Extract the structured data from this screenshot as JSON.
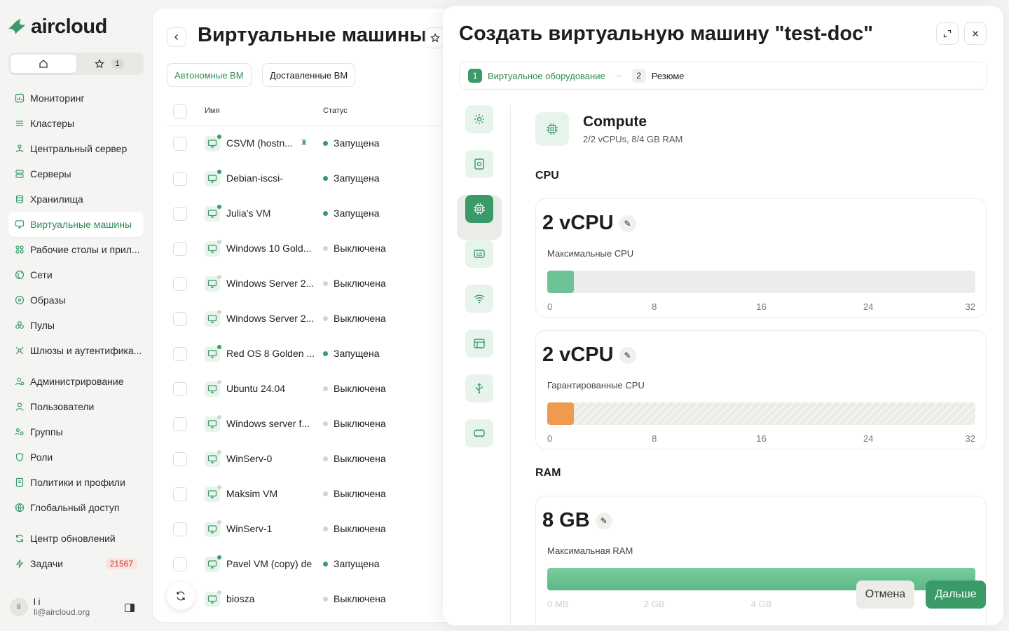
{
  "brand": {
    "name": "aircloud",
    "accent": "#3a9a68",
    "off_dot": "#d4d4d0",
    "on_dot": "#3a9a68"
  },
  "favorites": {
    "count": "1"
  },
  "nav": [
    {
      "label": "Мониторинг",
      "icon": "chart-icon"
    },
    {
      "label": "Кластеры",
      "icon": "layers-icon"
    },
    {
      "label": "Центральный сервер",
      "icon": "hub-icon"
    },
    {
      "label": "Серверы",
      "icon": "server-icon"
    },
    {
      "label": "Хранилища",
      "icon": "database-icon"
    },
    {
      "label": "Виртуальные машины",
      "icon": "monitor-icon",
      "active": true
    },
    {
      "label": "Рабочие столы и прил...",
      "icon": "apps-icon"
    },
    {
      "label": "Сети",
      "icon": "globe-icon"
    },
    {
      "label": "Образы",
      "icon": "disc-icon"
    },
    {
      "label": "Пулы",
      "icon": "pools-icon"
    },
    {
      "label": "Шлюзы и аутентифика...",
      "icon": "gateway-icon"
    },
    {
      "label": "Администрирование",
      "icon": "admin-icon"
    },
    {
      "label": "Пользователи",
      "icon": "user-icon"
    },
    {
      "label": "Группы",
      "icon": "group-icon"
    },
    {
      "label": "Роли",
      "icon": "shield-icon"
    },
    {
      "label": "Политики и профили",
      "icon": "policy-icon"
    },
    {
      "label": "Глобальный доступ",
      "icon": "globe-access-icon"
    },
    {
      "label": "Центр обновлений",
      "icon": "refresh-icon"
    },
    {
      "label": "Задачи",
      "icon": "bolt-icon",
      "badge": "21567"
    }
  ],
  "user": {
    "initials": "li",
    "name": "l i",
    "email": "li@aircloud.org"
  },
  "list": {
    "title": "Виртуальные машины",
    "tabs": [
      "Автономные ВМ",
      "Доставленные ВМ"
    ],
    "columns": {
      "name": "Имя",
      "status": "Статус"
    },
    "rows": [
      {
        "name": "CSVM (hostn...",
        "status": "Запущена",
        "on": true
      },
      {
        "name": "Debian-iscsi-",
        "status": "Запущена",
        "on": true
      },
      {
        "name": "Julia's VM",
        "status": "Запущена",
        "on": true
      },
      {
        "name": "Windows 10 Gold...",
        "status": "Выключена",
        "on": false
      },
      {
        "name": "Windows Server 2...",
        "status": "Выключена",
        "on": false
      },
      {
        "name": "Windows Server 2...",
        "status": "Выключена",
        "on": false
      },
      {
        "name": "Red OS 8 Golden ...",
        "status": "Запущена",
        "on": true
      },
      {
        "name": "Ubuntu 24.04",
        "status": "Выключена",
        "on": false
      },
      {
        "name": "Windows server f...",
        "status": "Выключена",
        "on": false
      },
      {
        "name": "WinServ-0",
        "status": "Выключена",
        "on": false
      },
      {
        "name": "Maksim VM",
        "status": "Выключена",
        "on": false
      },
      {
        "name": "WinServ-1",
        "status": "Выключена",
        "on": false
      },
      {
        "name": "Pavel VM (copy) de",
        "status": "Запущена",
        "on": true
      },
      {
        "name": "biosza",
        "status": "Выключена",
        "on": false
      }
    ]
  },
  "modal": {
    "title": "Создать виртуальную машину \"test-doc\"",
    "steps": [
      {
        "num": "1",
        "label": "Виртуальное оборудование"
      },
      {
        "num": "2",
        "label": "Резюме"
      }
    ],
    "side_tabs": [
      "settings-icon",
      "disk-icon",
      "cpu-icon",
      "display-icon",
      "wifi-icon",
      "window-icon",
      "usb-icon",
      "device-icon"
    ],
    "section": {
      "title": "Compute",
      "subtitle": "2/2 vCPUs, 8/4 GB RAM"
    },
    "cpu_label": "CPU",
    "ram_label": "RAM",
    "cpu_max": {
      "value": "2 vCPU",
      "label": "Максимальные CPU",
      "fraction": 0.0625,
      "color": "#6cc496",
      "ticks": [
        "0",
        "8",
        "16",
        "24",
        "32"
      ]
    },
    "cpu_guaranteed": {
      "value": "2 vCPU",
      "label": "Гарантированные CPU",
      "fraction": 0.0625,
      "color": "#ef9a4f",
      "ticks": [
        "0",
        "8",
        "16",
        "24",
        "32"
      ]
    },
    "ram_max": {
      "value": "8 GB",
      "label": "Максимальная RAM",
      "fraction": 1.0,
      "ticks": [
        "0 MB",
        "2 GB",
        "4 GB"
      ]
    },
    "buttons": {
      "cancel": "Отмена",
      "next": "Дальше"
    }
  }
}
